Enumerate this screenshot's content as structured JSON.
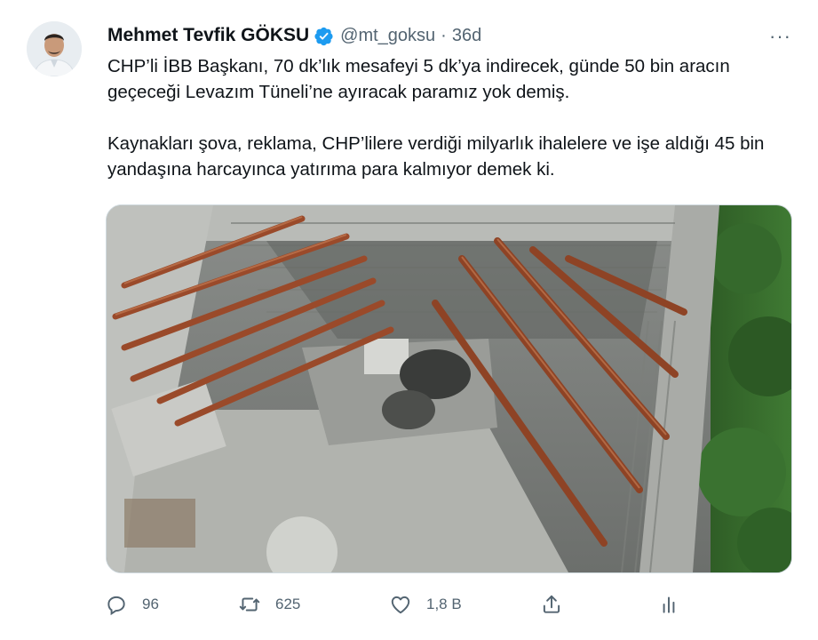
{
  "author": {
    "name": "Mehmet Tevfik GÖKSU",
    "handle": "@mt_goksu",
    "separator": "·",
    "time": "36d"
  },
  "icons": {
    "verified": "verified-badge-icon",
    "more": "more-icon",
    "reply": "reply-icon",
    "retweet": "retweet-icon",
    "like": "like-icon",
    "share": "share-icon",
    "analytics": "analytics-icon"
  },
  "more_label": "···",
  "tweet": {
    "paragraphs": [
      "CHP’li İBB Başkanı, 70 dk’lık mesafeyi 5 dk’ya indirecek, günde 50 bin aracın geçeceği Levazım Tüneli’ne ayıracak paramız yok demiş.",
      "Kaynakları şova, reklama, CHP’lilere verdiği milyarlık ihalelere ve işe aldığı 45 bin yandaşına harcayınca yatırıma para kalmıyor demek ki."
    ]
  },
  "actions": {
    "replies": "96",
    "retweets": "625",
    "likes": "1,8 B"
  },
  "colors": {
    "verified": "#1d9bf0",
    "secondary_text": "#536471",
    "rust_beam": "#9a4a2a"
  }
}
